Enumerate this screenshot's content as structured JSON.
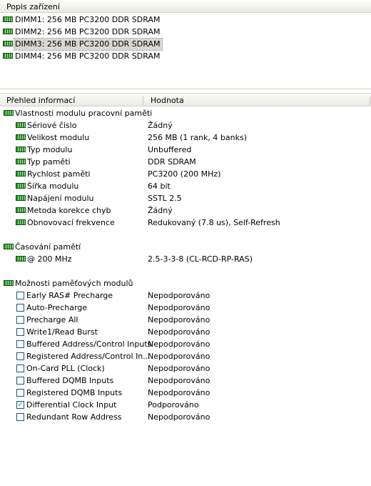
{
  "device_pane": {
    "header": "Popis zařízení",
    "devices": [
      {
        "label": "DIMM1: 256 MB PC3200 DDR SDRAM",
        "selected": false
      },
      {
        "label": "DIMM2: 256 MB PC3200 DDR SDRAM",
        "selected": false
      },
      {
        "label": "DIMM3: 256 MB PC3200 DDR SDRAM",
        "selected": true
      },
      {
        "label": "DIMM4: 256 MB PC3200 DDR SDRAM",
        "selected": false
      }
    ]
  },
  "details_pane": {
    "col_field": "Přehled informací",
    "col_value": "Hodnota",
    "module_props": {
      "title": "Vlastnosti modulu pracovní paměti",
      "rows": [
        {
          "field": "Sériové číslo",
          "value": "Žádný"
        },
        {
          "field": "Velikost modulu",
          "value": "256 MB (1 rank, 4 banks)"
        },
        {
          "field": "Typ modulu",
          "value": "Unbuffered"
        },
        {
          "field": "Typ paměti",
          "value": "DDR SDRAM"
        },
        {
          "field": "Rychlost paměti",
          "value": "PC3200 (200 MHz)"
        },
        {
          "field": "Šířka modulu",
          "value": "64 bit"
        },
        {
          "field": "Napájení modulu",
          "value": "SSTL 2.5"
        },
        {
          "field": "Metoda korekce chyb",
          "value": "Žádný"
        },
        {
          "field": "Obnovovací frekvence",
          "value": "Redukovaný (7.8 us), Self-Refresh"
        }
      ]
    },
    "timing": {
      "title": "Časování pamětí",
      "rows": [
        {
          "field": "@ 200 MHz",
          "value": "2.5-3-3-8  (CL-RCD-RP-RAS)"
        }
      ]
    },
    "features": {
      "title": "Možnosti paměťových modulů",
      "rows": [
        {
          "field": "Early RAS# Precharge",
          "value": "Nepodporováno",
          "checked": false
        },
        {
          "field": "Auto-Precharge",
          "value": "Nepodporováno",
          "checked": false
        },
        {
          "field": "Precharge All",
          "value": "Nepodporováno",
          "checked": false
        },
        {
          "field": "Write1/Read Burst",
          "value": "Nepodporováno",
          "checked": false
        },
        {
          "field": "Buffered Address/Control Inputs",
          "value": "Nepodporováno",
          "checked": false
        },
        {
          "field": "Registered Address/Control In...",
          "value": "Nepodporováno",
          "checked": false
        },
        {
          "field": "On-Card PLL (Clock)",
          "value": "Nepodporováno",
          "checked": false
        },
        {
          "field": "Buffered DQMB Inputs",
          "value": "Nepodporováno",
          "checked": false
        },
        {
          "field": "Registered DQMB Inputs",
          "value": "Nepodporováno",
          "checked": false
        },
        {
          "field": "Differential Clock Input",
          "value": "Podporováno",
          "checked": true
        },
        {
          "field": "Redundant Row Address",
          "value": "Nepodporováno",
          "checked": false
        }
      ]
    }
  },
  "icons": {
    "module": "memory-module-icon",
    "checkbox": "checkbox-icon"
  }
}
